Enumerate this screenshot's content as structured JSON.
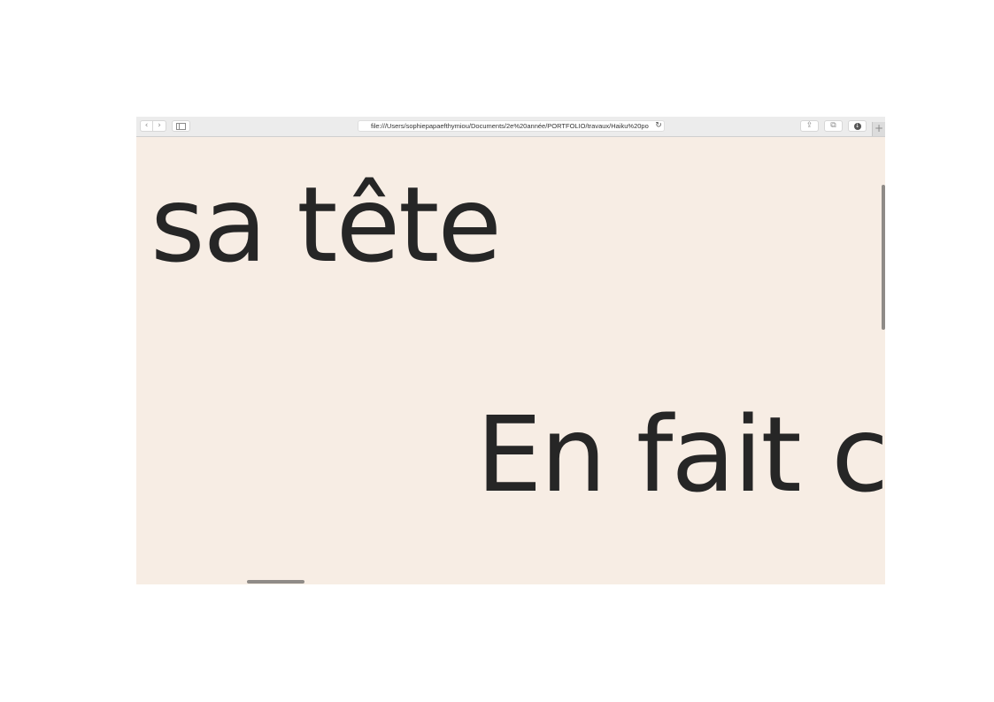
{
  "browser": {
    "url": "file:///Users/sophiepapaefthymiou/Documents/2e%20année/PORTFOLIO/travaux/Haiku%20po",
    "back_icon": "chevron-left-icon",
    "forward_icon": "chevron-right-icon",
    "sidebar_icon": "sidebar-icon",
    "reload_icon": "reload-icon",
    "share_icon": "share-icon",
    "tabs_icon": "tabs-overview-icon",
    "download_icon": "download-icon",
    "new_tab_icon": "plus-icon"
  },
  "page": {
    "line1": "sa tête",
    "line2": "En fait c",
    "background_color": "#f7ede4",
    "text_color": "#262626"
  }
}
